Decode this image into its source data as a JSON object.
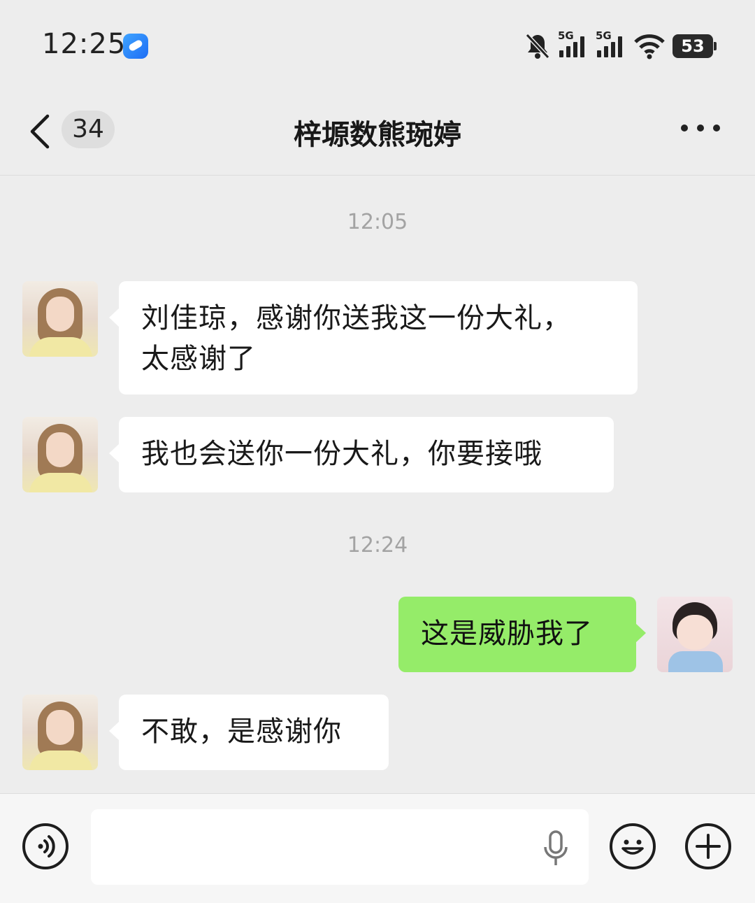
{
  "status_bar": {
    "time": "12:25",
    "signal_1_label": "5G",
    "signal_2_label": "5G",
    "battery": "53",
    "icons": [
      "app-icon",
      "mute-bell-icon",
      "signal-icon",
      "signal-icon",
      "wifi-icon",
      "battery-icon"
    ]
  },
  "nav": {
    "unread_count": "34",
    "title": "梓塬数熊琬婷",
    "icons": [
      "back-chevron-icon",
      "more-dots-icon"
    ]
  },
  "messages": [
    {
      "type": "time",
      "text": "12:05"
    },
    {
      "type": "incoming",
      "sender": "contact",
      "text_line1": "刘佳琼，感谢你送我这一份大礼，",
      "text_line2": "太感谢了"
    },
    {
      "type": "incoming",
      "sender": "contact",
      "text": "我也会送你一份大礼，你要接哦"
    },
    {
      "type": "time",
      "text": "12:24"
    },
    {
      "type": "outgoing",
      "sender": "me",
      "text": "这是威胁我了"
    },
    {
      "type": "incoming",
      "sender": "contact",
      "text": "不敢，是感谢你"
    }
  ],
  "input_bar": {
    "value": "",
    "icons": [
      "voice-mode-icon",
      "microphone-icon",
      "emoji-icon",
      "plus-icon"
    ]
  }
}
